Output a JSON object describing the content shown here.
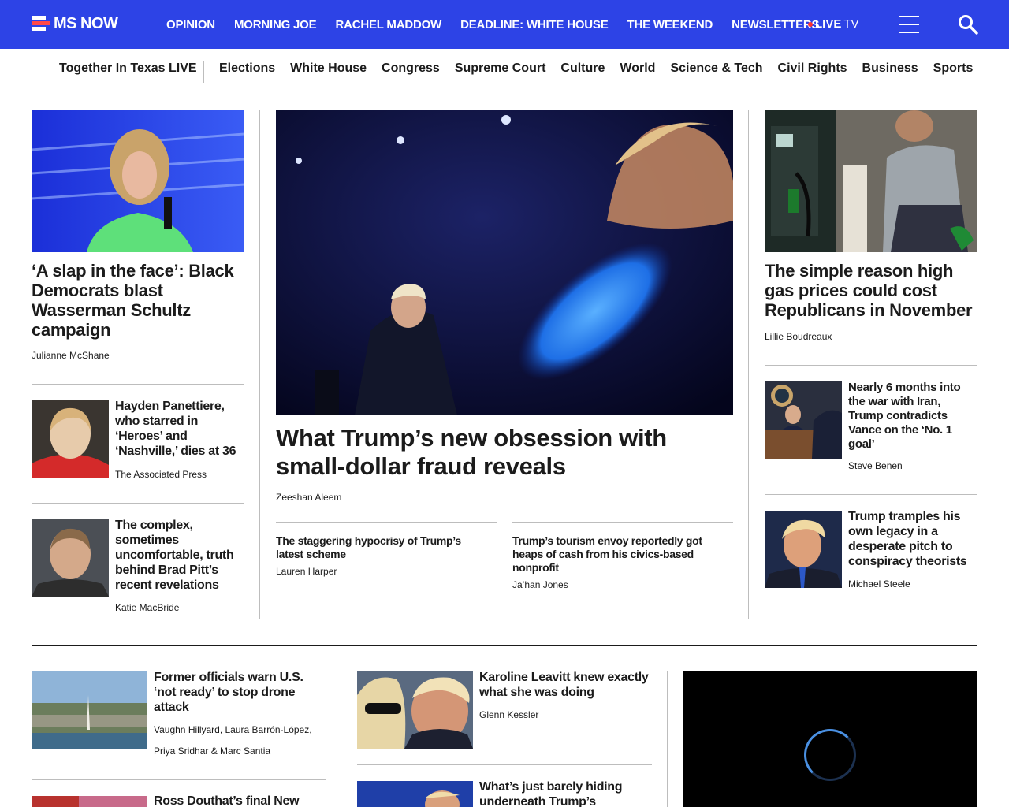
{
  "header": {
    "logo": "MS NOW",
    "nav": [
      "OPINION",
      "MORNING JOE",
      "RACHEL MADDOW",
      "DEADLINE: WHITE HOUSE",
      "THE WEEKEND",
      "NEWSLETTERS"
    ],
    "live_label": "LIVE",
    "live_tv": "TV",
    "brand_color": "#2d43e6"
  },
  "subnav": {
    "featured": "Together In Texas LIVE",
    "items": [
      "Elections",
      "White House",
      "Congress",
      "Supreme Court",
      "Culture",
      "World",
      "Science & Tech",
      "Civil Rights",
      "Business",
      "Sports"
    ]
  },
  "left": {
    "lead": {
      "headline": "‘A slap in the face’: Black Democrats blast Wasserman Schultz campaign",
      "byline": "Julianne McShane"
    },
    "stories": [
      {
        "headline": "Hayden Panettiere, who starred in ‘Heroes’ and ‘Nashville,’ dies at 36",
        "byline": "The Associated Press"
      },
      {
        "headline": "The complex, sometimes uncomfortable, truth behind Brad Pitt’s recent revelations",
        "byline": "Katie MacBride"
      }
    ]
  },
  "center": {
    "hero": {
      "headline": "What Trump’s new obsession with small-dollar fraud reveals",
      "byline": "Zeeshan Aleem"
    },
    "related": [
      {
        "headline": "The staggering hypocrisy of Trump’s latest scheme",
        "byline": "Lauren Harper"
      },
      {
        "headline": "Trump’s tourism envoy reportedly got heaps of cash from his civics-based nonprofit",
        "byline": "Ja’han Jones"
      }
    ]
  },
  "right": {
    "lead": {
      "headline": "The simple reason high gas prices could cost Republicans in November",
      "byline": "Lillie Boudreaux"
    },
    "stories": [
      {
        "headline": "Nearly 6 months into the war with Iran, Trump contradicts Vance on the ‘No. 1 goal’",
        "byline": "Steve Benen"
      },
      {
        "headline": "Trump tramples his own legacy in a desperate pitch to conspiracy theorists",
        "byline": "Michael Steele"
      }
    ]
  },
  "bottom": {
    "col1": [
      {
        "headline": "Former officials warn U.S. ‘not ready’ to stop drone attack",
        "byline_line1": "Vaughn Hillyard, Laura Barrón-López,",
        "byline_line2": "Priya Sridhar & Marc Santia"
      },
      {
        "headline": "Ross Douthat’s final New"
      }
    ],
    "col2": [
      {
        "headline": "Karoline Leavitt knew exactly what she was doing",
        "byline": "Glenn Kessler"
      },
      {
        "headline": "What’s just barely hiding underneath Trump’s"
      }
    ]
  }
}
